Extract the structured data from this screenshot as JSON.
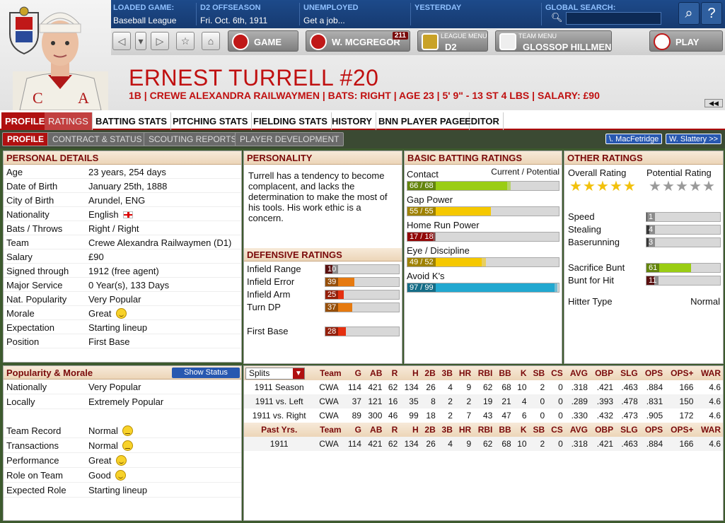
{
  "topbar": {
    "loaded_game_label": "LOADED GAME:",
    "loaded_game_value": "Baseball League",
    "season_label": "D2 OFFSEASON",
    "season_value": "Fri. Oct. 6th, 1911",
    "job_label": "UNEMPLOYED",
    "job_value": "Get a job...",
    "yesterday_label": "YESTERDAY",
    "search_label": "GLOBAL SEARCH:",
    "search_value": ""
  },
  "nav": {
    "game_label": "GAME",
    "manager_label": "W. MCGREGOR",
    "manager_badge": "211",
    "league_menu_sub": "LEAGUE MENU",
    "league_menu_main": "D2",
    "team_menu_sub": "TEAM MENU",
    "team_menu_main": "GLOSSOP HILLMEN",
    "play_label": "PLAY"
  },
  "player": {
    "name": "ERNEST TURRELL  #20",
    "info": "1B | CREWE ALEXANDRA RAILWAYMEN | BATS: RIGHT | AGE 23 | 5' 9\" - 13 ST 4 LBS | SALARY: £90"
  },
  "tabs": [
    "PROFILE",
    "RATINGS",
    "BATTING STATS",
    "PITCHING STATS",
    "FIELDING STATS",
    "HISTORY",
    "BNN PLAYER PAGE",
    "EDITOR"
  ],
  "subtabs": [
    "PROFILE",
    "CONTRACT & STATUS",
    "SCOUTING REPORTS",
    "PLAYER DEVELOPMENT"
  ],
  "prev_player": "\\. MacFetridge",
  "next_player": "W. Slattery >>",
  "personal": {
    "title": "PERSONAL DETAILS",
    "rows": [
      [
        "Age",
        "23 years, 254 days"
      ],
      [
        "Date of Birth",
        "January 25th, 1888"
      ],
      [
        "City of Birth",
        "Arundel, ENG"
      ],
      [
        "Nationality",
        "English"
      ],
      [
        "Bats / Throws",
        "Right / Right"
      ],
      [
        "Team",
        "Crewe Alexandra Railwaymen (D1)"
      ],
      [
        "Salary",
        "£90"
      ],
      [
        "Signed through",
        "1912 (free agent)"
      ],
      [
        "Major Service",
        "0 Year(s), 133 Days"
      ],
      [
        "Nat. Popularity",
        "Very Popular"
      ],
      [
        "Morale",
        "Great"
      ],
      [
        "Expectation",
        "Starting lineup"
      ],
      [
        "Position",
        "First Base"
      ]
    ]
  },
  "popularity": {
    "title": "Popularity & Morale",
    "button": "Show Status",
    "rows": [
      [
        "Nationally",
        "Very Popular"
      ],
      [
        "Locally",
        "Extremely Popular"
      ],
      [
        "Team Record",
        "Normal"
      ],
      [
        "Transactions",
        "Normal"
      ],
      [
        "Performance",
        "Great"
      ],
      [
        "Role on Team",
        "Good"
      ],
      [
        "Expected Role",
        "Starting lineup"
      ]
    ]
  },
  "personality": {
    "title": "PERSONALITY",
    "text": "Turrell has a tendency to become complacent, and lacks the determination to make the most of his tools. His work ethic is a concern."
  },
  "defensive": {
    "title": "DEFENSIVE RATINGS",
    "rows": [
      {
        "label": "Infield Range",
        "value": "10",
        "fill": 0.1,
        "color": "#8b1a1a"
      },
      {
        "label": "Infield Error",
        "value": "39",
        "fill": 0.39,
        "color": "#e67a10"
      },
      {
        "label": "Infield Arm",
        "value": "25",
        "fill": 0.25,
        "color": "#e53010"
      },
      {
        "label": "Turn DP",
        "value": "37",
        "fill": 0.37,
        "color": "#e67a10"
      },
      {
        "label": "First Base",
        "value": "28",
        "fill": 0.28,
        "color": "#e53010"
      }
    ]
  },
  "batting": {
    "title": "BASIC BATTING RATINGS",
    "header_left": "Contact",
    "header_right": "Current / Potential",
    "rows": [
      {
        "label": "Contact",
        "value": "66 / 68",
        "cur": 0.66,
        "pot": 0.68,
        "color": "#9acd14"
      },
      {
        "label": "Gap Power",
        "value": "55 / 55",
        "cur": 0.55,
        "pot": 0.55,
        "color": "#f5c800"
      },
      {
        "label": "Home Run Power",
        "value": "17 / 18",
        "cur": 0.17,
        "pot": 0.18,
        "color": "#e01010"
      },
      {
        "label": "Eye / Discipline",
        "value": "49 / 52",
        "cur": 0.49,
        "pot": 0.52,
        "color": "#f5c800"
      },
      {
        "label": "Avoid K's",
        "value": "97 / 99",
        "cur": 0.97,
        "pot": 0.99,
        "color": "#22a8d0"
      }
    ]
  },
  "other": {
    "title": "OTHER RATINGS",
    "overall_label": "Overall Rating",
    "potential_label": "Potential Rating",
    "overall_stars": 5,
    "potential_stars": 0,
    "rows": [
      {
        "label": "Speed",
        "value": "1",
        "fill": 0.01,
        "color": "#555"
      },
      {
        "label": "Stealing",
        "value": "4",
        "fill": 0.04,
        "color": "#555"
      },
      {
        "label": "Baserunning",
        "value": "3",
        "fill": 0.03,
        "color": "#555"
      },
      {
        "label": "Sacrifice Bunt",
        "value": "61",
        "fill": 0.61,
        "color": "#9acd14"
      },
      {
        "label": "Bunt for Hit",
        "value": "11",
        "fill": 0.11,
        "color": "#8b1a1a"
      }
    ],
    "hitter_type_label": "Hitter Type",
    "hitter_type_value": "Normal"
  },
  "stats": {
    "splits_label": "Splits",
    "headers": [
      "Team",
      "G",
      "AB",
      "R",
      "H",
      "2B",
      "3B",
      "HR",
      "RBI",
      "BB",
      "K",
      "SB",
      "CS",
      "AVG",
      "OBP",
      "SLG",
      "OPS",
      "OPS+",
      "WAR"
    ],
    "past_label": "Past Yrs.",
    "rows": [
      [
        "1911 Season",
        "CWA",
        "114",
        "421",
        "62",
        "134",
        "26",
        "4",
        "9",
        "62",
        "68",
        "10",
        "2",
        "0",
        ".318",
        ".421",
        ".463",
        ".884",
        "166",
        "4.6"
      ],
      [
        "1911 vs. Left",
        "CWA",
        "37",
        "121",
        "16",
        "35",
        "8",
        "2",
        "2",
        "19",
        "21",
        "4",
        "0",
        "0",
        ".289",
        ".393",
        ".478",
        ".831",
        "150",
        "4.6"
      ],
      [
        "1911 vs. Right",
        "CWA",
        "89",
        "300",
        "46",
        "99",
        "18",
        "2",
        "7",
        "43",
        "47",
        "6",
        "0",
        "0",
        ".330",
        ".432",
        ".473",
        ".905",
        "172",
        "4.6"
      ]
    ],
    "past_rows": [
      [
        "1911",
        "CWA",
        "114",
        "421",
        "62",
        "134",
        "26",
        "4",
        "9",
        "62",
        "68",
        "10",
        "2",
        "0",
        ".318",
        ".421",
        ".463",
        ".884",
        "166",
        "4.6"
      ]
    ]
  }
}
